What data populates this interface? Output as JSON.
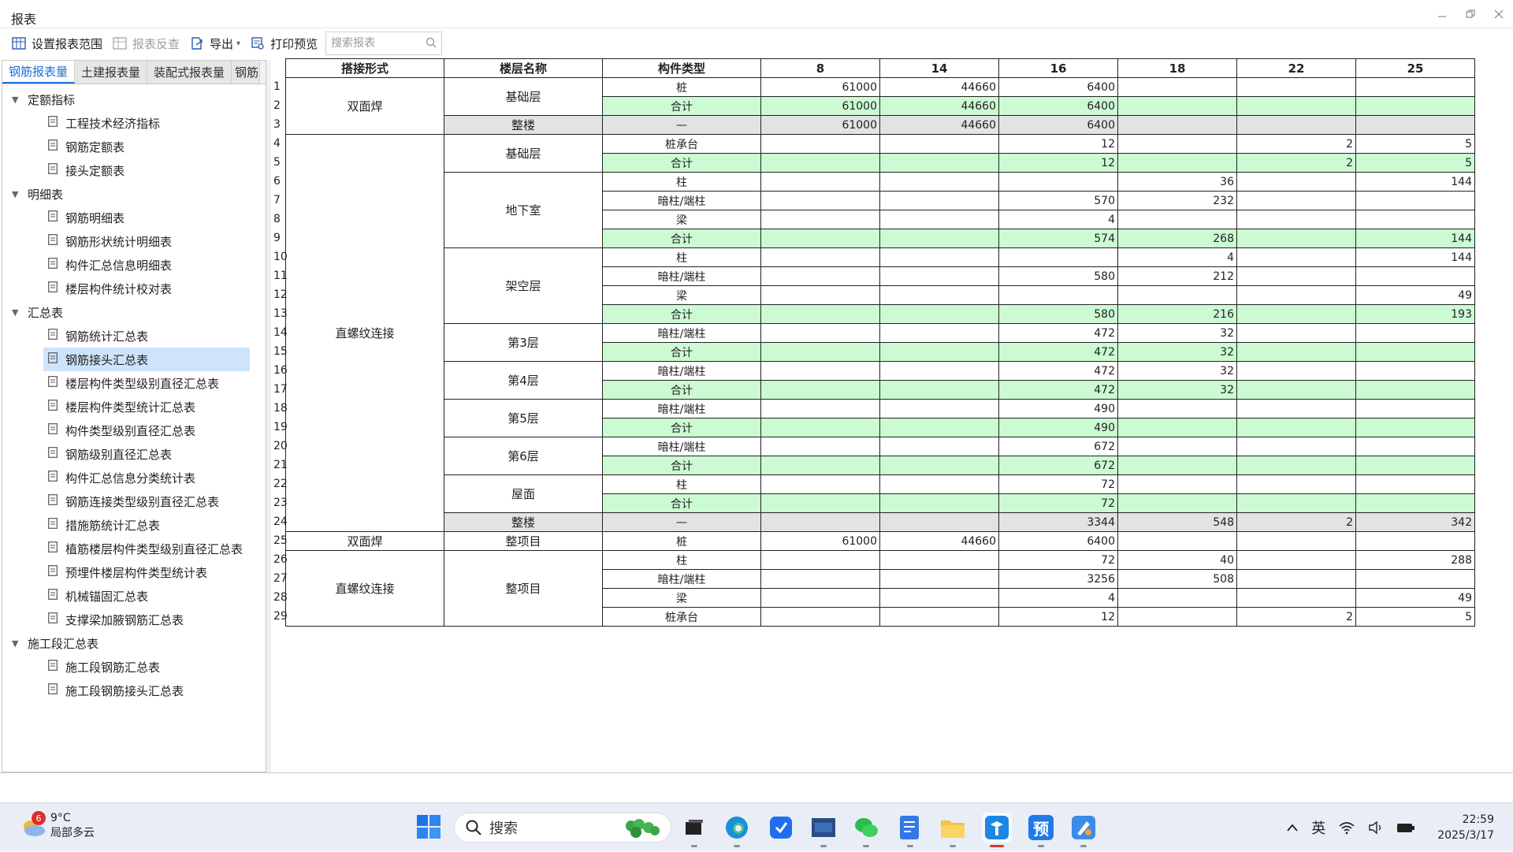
{
  "window": {
    "title": "报表"
  },
  "toolbar": {
    "set_range": "设置报表范围",
    "reverse": "报表反查",
    "export": "导出",
    "print_preview": "打印预览",
    "search_placeholder": "搜索报表"
  },
  "tabs": [
    "钢筋报表量",
    "土建报表量",
    "装配式报表量",
    "钢筋"
  ],
  "tree": {
    "g1": {
      "label": "定额指标",
      "items": [
        "工程技术经济指标",
        "钢筋定额表",
        "接头定额表"
      ]
    },
    "g2": {
      "label": "明细表",
      "items": [
        "钢筋明细表",
        "钢筋形状统计明细表",
        "构件汇总信息明细表",
        "楼层构件统计校对表"
      ]
    },
    "g3": {
      "label": "汇总表",
      "items": [
        "钢筋统计汇总表",
        "钢筋接头汇总表",
        "楼层构件类型级别直径汇总表",
        "楼层构件类型统计汇总表",
        "构件类型级别直径汇总表",
        "钢筋级别直径汇总表",
        "构件汇总信息分类统计表",
        "钢筋连接类型级别直径汇总表",
        "措施筋统计汇总表",
        "植筋楼层构件类型级别直径汇总表",
        "预埋件楼层构件类型统计表",
        "机械锚固汇总表",
        "支撑梁加腋钢筋汇总表"
      ]
    },
    "g4": {
      "label": "施工段汇总表",
      "items": [
        "施工段钢筋汇总表",
        "施工段钢筋接头汇总表"
      ]
    }
  },
  "table": {
    "headers": [
      "搭接形式",
      "楼层名称",
      "构件类型",
      "8",
      "14",
      "16",
      "18",
      "22",
      "25"
    ],
    "row_numbers": [
      "1",
      "2",
      "3",
      "4",
      "5",
      "6",
      "7",
      "8",
      "9",
      "10",
      "11",
      "12",
      "13",
      "14",
      "15",
      "16",
      "17",
      "18",
      "19",
      "20",
      "21",
      "22",
      "23",
      "24",
      "25",
      "26",
      "27",
      "28",
      "29"
    ],
    "g": {
      "a": "双面焊",
      "b": "直螺纹连接",
      "c": "双面焊",
      "d": "直螺纹连接"
    },
    "f": {
      "a1": "基础层",
      "a2": "整楼",
      "b1": "基础层",
      "b2": "地下室",
      "b3": "架空层",
      "b4": "第3层",
      "b5": "第4层",
      "b6": "第5层",
      "b7": "第6层",
      "b8": "屋面",
      "b9": "整楼",
      "c1": "整项目",
      "d1": "整项目"
    },
    "r": {
      "r1": [
        "桩",
        "61000",
        "44660",
        "6400",
        "",
        "",
        ""
      ],
      "r2": [
        "合计",
        "61000",
        "44660",
        "6400",
        "",
        "",
        ""
      ],
      "r3": [
        "—",
        "61000",
        "44660",
        "6400",
        "",
        "",
        ""
      ],
      "r4": [
        "桩承台",
        "",
        "",
        "12",
        "",
        "2",
        "5"
      ],
      "r5": [
        "合计",
        "",
        "",
        "12",
        "",
        "2",
        "5"
      ],
      "r6": [
        "柱",
        "",
        "",
        "",
        "36",
        "",
        "144"
      ],
      "r7": [
        "暗柱/端柱",
        "",
        "",
        "570",
        "232",
        "",
        ""
      ],
      "r8": [
        "梁",
        "",
        "",
        "4",
        "",
        "",
        ""
      ],
      "r9": [
        "合计",
        "",
        "",
        "574",
        "268",
        "",
        "144"
      ],
      "r10": [
        "柱",
        "",
        "",
        "",
        "4",
        "",
        "144"
      ],
      "r11": [
        "暗柱/端柱",
        "",
        "",
        "580",
        "212",
        "",
        ""
      ],
      "r12": [
        "梁",
        "",
        "",
        "",
        "",
        "",
        "49"
      ],
      "r13": [
        "合计",
        "",
        "",
        "580",
        "216",
        "",
        "193"
      ],
      "r14": [
        "暗柱/端柱",
        "",
        "",
        "472",
        "32",
        "",
        ""
      ],
      "r15": [
        "合计",
        "",
        "",
        "472",
        "32",
        "",
        ""
      ],
      "r16": [
        "暗柱/端柱",
        "",
        "",
        "472",
        "32",
        "",
        ""
      ],
      "r17": [
        "合计",
        "",
        "",
        "472",
        "32",
        "",
        ""
      ],
      "r18": [
        "暗柱/端柱",
        "",
        "",
        "490",
        "",
        "",
        ""
      ],
      "r19": [
        "合计",
        "",
        "",
        "490",
        "",
        "",
        ""
      ],
      "r20": [
        "暗柱/端柱",
        "",
        "",
        "672",
        "",
        "",
        ""
      ],
      "r21": [
        "合计",
        "",
        "",
        "672",
        "",
        "",
        ""
      ],
      "r22": [
        "柱",
        "",
        "",
        "72",
        "",
        "",
        ""
      ],
      "r23": [
        "合计",
        "",
        "",
        "72",
        "",
        "",
        ""
      ],
      "r24": [
        "—",
        "",
        "",
        "3344",
        "548",
        "2",
        "342"
      ],
      "r25": [
        "桩",
        "61000",
        "44660",
        "6400",
        "",
        "",
        ""
      ],
      "r26": [
        "柱",
        "",
        "",
        "72",
        "40",
        "",
        "288"
      ],
      "r27": [
        "暗柱/端柱",
        "",
        "",
        "3256",
        "508",
        "",
        ""
      ],
      "r28": [
        "梁",
        "",
        "",
        "4",
        "",
        "",
        "49"
      ],
      "r29": [
        "桩承台",
        "",
        "",
        "12",
        "",
        "2",
        "5"
      ]
    }
  },
  "taskbar": {
    "weather_temp": "9°C",
    "weather_desc": "局部多云",
    "weather_badge": "6",
    "search_placeholder": "搜索",
    "ime": "英",
    "time": "22:59",
    "date": "2025/3/17",
    "app_preview": "预"
  },
  "colors": {
    "sum_row": "#ccfbd3",
    "total_row": "#e3e3e3",
    "selected_item": "#cfe3fb",
    "active_tab": "#1e6fd9"
  }
}
